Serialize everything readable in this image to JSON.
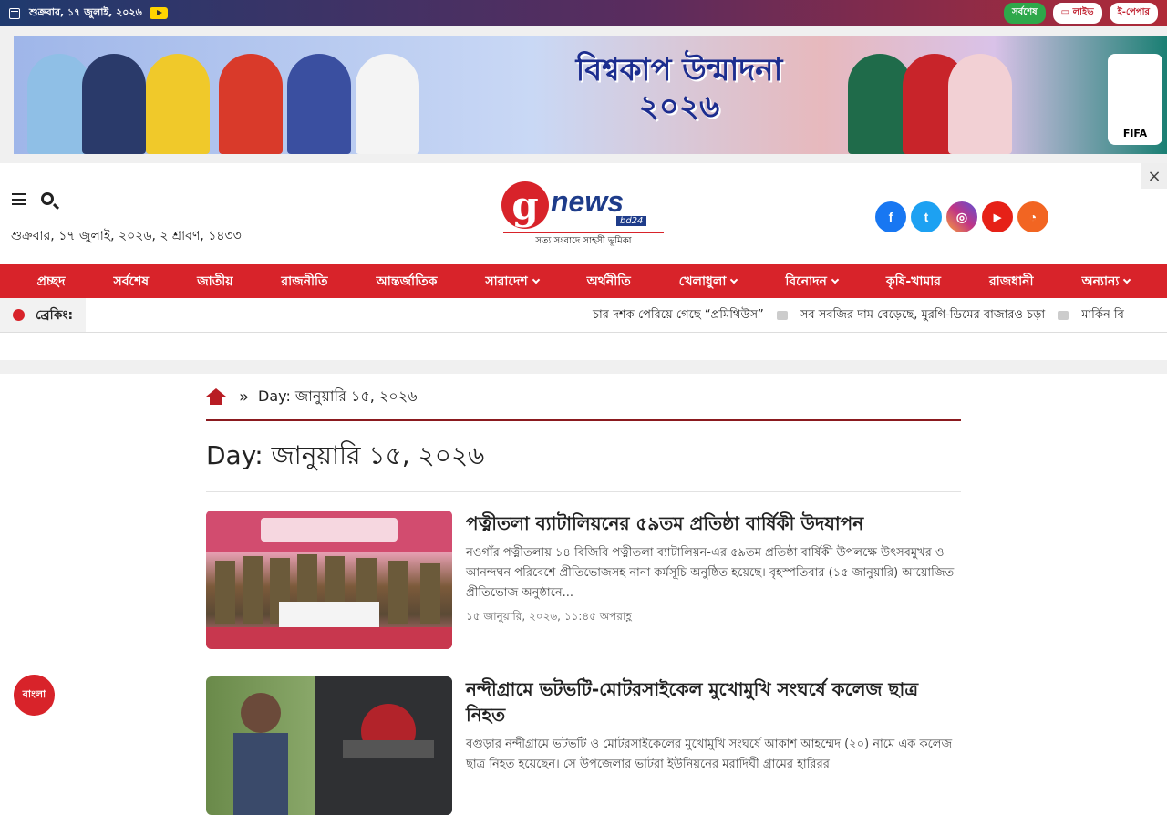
{
  "topbar": {
    "date": "শুক্রবার, ১৭ জুলাই, ২০২৬",
    "buttons": [
      "সর্বশেষ",
      "লাইভ",
      "ই-পেপার"
    ]
  },
  "banner": {
    "title_line1": "বিশ্বকাপ উন্মাদনা",
    "title_line2": "২০২৬",
    "badge": "FIFA"
  },
  "header": {
    "date": "শুক্রবার, ১৭ জুলাই, ২০২৬, ২ শ্রাবণ, ১৪৩৩",
    "logo_g": "g",
    "logo_news": "news",
    "logo_bd": "bd24",
    "tagline": "সত্য সংবাদে সাহসী ভূমিকা",
    "close": "×"
  },
  "socials": [
    {
      "name": "facebook",
      "glyph": "f",
      "color": "#1877f2"
    },
    {
      "name": "twitter",
      "glyph": "t",
      "color": "#1da1f2"
    },
    {
      "name": "instagram",
      "glyph": "◎",
      "color": "#c13584"
    },
    {
      "name": "youtube",
      "glyph": "▶",
      "color": "#e62117"
    },
    {
      "name": "rss",
      "glyph": "◔",
      "color": "#f26522"
    }
  ],
  "nav": [
    {
      "label": "প্রচ্ছদ",
      "dropdown": false
    },
    {
      "label": "সর্বশেষ",
      "dropdown": false
    },
    {
      "label": "জাতীয়",
      "dropdown": false
    },
    {
      "label": "রাজনীতি",
      "dropdown": false
    },
    {
      "label": "আন্তর্জাতিক",
      "dropdown": false
    },
    {
      "label": "সারাদেশ",
      "dropdown": true
    },
    {
      "label": "অর্থনীতি",
      "dropdown": false
    },
    {
      "label": "খেলাধুলা",
      "dropdown": true
    },
    {
      "label": "বিনোদন",
      "dropdown": true
    },
    {
      "label": "কৃষি-খামার",
      "dropdown": false
    },
    {
      "label": "রাজধানী",
      "dropdown": false
    },
    {
      "label": "অন্যান্য",
      "dropdown": true
    }
  ],
  "breaking": {
    "label": "ব্রেকিং:",
    "items": [
      "চার দশক পেরিয়ে গেছে “প্রমিথিউস”",
      "সব সবজির দাম বেড়েছে, মুরগি-ডিমের বাজারও চড়া",
      "মার্কিন বি"
    ]
  },
  "breadcrumb": {
    "sep": "»",
    "current": "Day: জানুয়ারি ১৫, ২০২৬"
  },
  "page_title": "Day: জানুয়ারি ১৫, ২০২৬",
  "articles": [
    {
      "title": "পত্নীতলা ব্যাটালিয়নের ৫৯তম প্রতিষ্ঠা বার্ষিকী উদযাপন",
      "excerpt": "নওগাঁর পত্নীতলায় ১৪ বিজিবি পত্নীতলা ব্যাটালিয়ন-এর ৫৯তম প্রতিষ্ঠা বার্ষিকী উপলক্ষে উৎসবমুখর ও আনন্দঘন পরিবেশে প্রীতিভোজসহ নানা কর্মসূচি অনুষ্ঠিত হয়েছে। বৃহস্পতিবার (১৫ জানুয়ারি) আয়োজিত প্রীতিভোজ অনুষ্ঠানে...",
      "date": "১৫ জানুয়ারি, ২০২৬, ১১:৪৫ অপরাহ্ণ"
    },
    {
      "title": "নন্দীগ্রামে ভটভটি-মোটরসাইকেল মুখোমুখি সংঘর্ষে কলেজ ছাত্র নিহত",
      "excerpt": "বগুড়ার নন্দীগ্রামে ভটভটি ও মোটরসাইকেলের মুখোমুখি সংঘর্ষে আকাশ আহম্মেদ (২০) নামে এক কলেজ ছাত্র নিহত হয়েছেন। সে উপজেলার ভাটরা ইউনিয়নের মরাদিঘী গ্রামের হারিরর",
      "date": ""
    }
  ],
  "lang_button": "বাংলা"
}
